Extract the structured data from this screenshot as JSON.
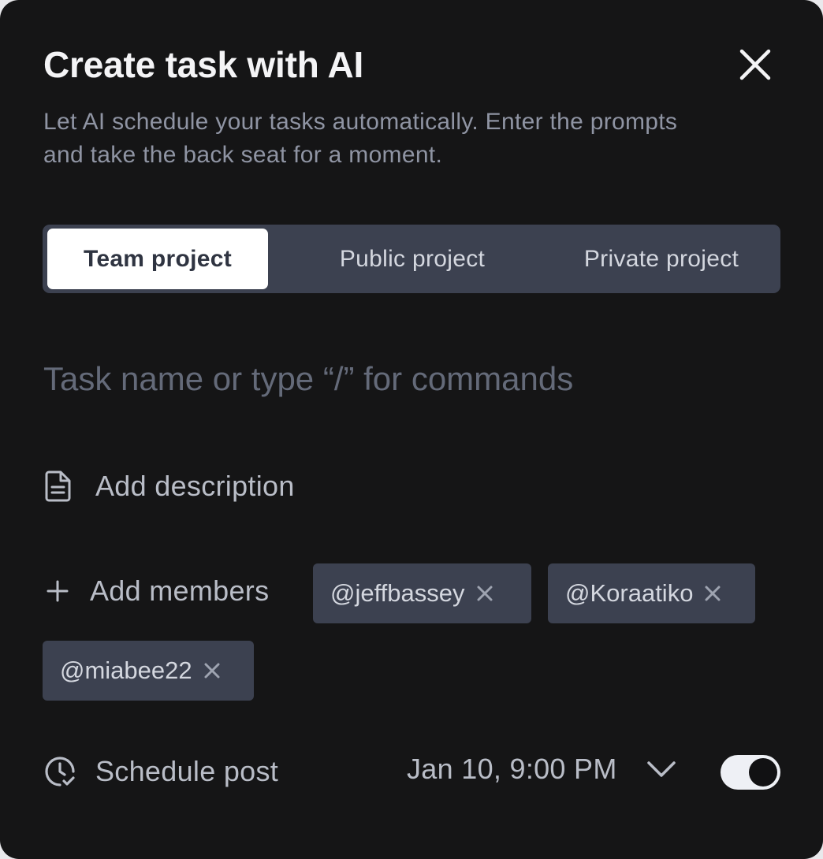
{
  "dialog": {
    "title": "Create task with AI",
    "subtitle": "Let AI schedule your tasks automatically. Enter the prompts and take the back seat for a moment.",
    "close_icon": "close-icon"
  },
  "tabs": [
    {
      "label": "Team project",
      "active": true
    },
    {
      "label": "Public project",
      "active": false
    },
    {
      "label": "Private project",
      "active": false
    }
  ],
  "task": {
    "value": "",
    "placeholder": "Task name or type “/” for commands"
  },
  "description": {
    "icon": "document-icon",
    "label": "Add description"
  },
  "members": {
    "icon": "plus-icon",
    "label": "Add members",
    "chips": [
      {
        "label": "@jeffbassey",
        "remove_icon": "remove-icon"
      },
      {
        "label": "@Koraatiko",
        "remove_icon": "remove-icon"
      },
      {
        "label": "@miabee22",
        "remove_icon": "remove-icon"
      }
    ]
  },
  "schedule": {
    "icon": "clock-check-icon",
    "label": "Schedule post",
    "date_value": "Jan 10, 9:00 PM",
    "dropdown_icon": "chevron-down-icon",
    "toggle_on": true
  },
  "colors": {
    "background": "#151516",
    "tab_bar": "#3c4150",
    "chip": "#3c4150",
    "text_primary": "#f4f4f6",
    "text_muted": "#8f94a3"
  }
}
